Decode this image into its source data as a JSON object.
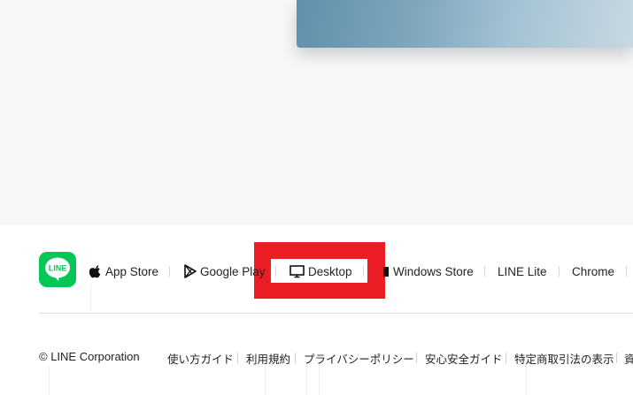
{
  "store_links": [
    {
      "label": "App Store",
      "icon": "apple-icon"
    },
    {
      "label": "Google Play",
      "icon": "google-play-icon"
    },
    {
      "label": "Desktop",
      "icon": "monitor-icon"
    },
    {
      "label": "Windows Store",
      "icon": "windows-icon"
    },
    {
      "label": "LINE Lite",
      "icon": ""
    },
    {
      "label": "Chrome",
      "icon": ""
    }
  ],
  "logo": {
    "text": "LINE",
    "icon": "line-logo-icon",
    "color": "#06c755"
  },
  "highlight_color": "#ec1d25",
  "footer": {
    "copyright": "© LINE Corporation",
    "links": [
      "使い方ガイド",
      "利用規約",
      "プライバシーポリシー",
      "安心安全ガイド",
      "特定商取引法の表示",
      "資"
    ]
  }
}
